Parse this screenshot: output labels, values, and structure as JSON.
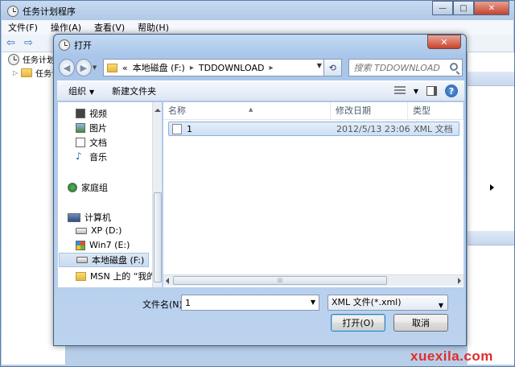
{
  "outer_window": {
    "title": "任务计划程序",
    "menu": [
      "文件(F)",
      "操作(A)",
      "查看(V)",
      "帮助(H)"
    ],
    "tree": [
      "任务计划",
      "任务计"
    ],
    "close_glyph": "✕",
    "min_glyph": "—",
    "max_glyph": "□"
  },
  "dialog": {
    "title": "打开",
    "close_glyph": "✕",
    "address": {
      "prefix": "«",
      "segments": [
        "本地磁盘 (F:)",
        "TDDOWNLOAD"
      ],
      "separator": "▸"
    },
    "search_placeholder": "搜索 TDDOWNLOAD",
    "toolbar": {
      "organize": "组织",
      "new_folder": "新建文件夹",
      "help": "?"
    },
    "nav_items": [
      {
        "label": "视频",
        "icon": "video-icon"
      },
      {
        "label": "图片",
        "icon": "picture-icon"
      },
      {
        "label": "文档",
        "icon": "document-icon"
      },
      {
        "label": "音乐",
        "icon": "music-icon"
      },
      {
        "label": "家庭组",
        "icon": "homegroup-icon"
      },
      {
        "label": "计算机",
        "icon": "computer-icon"
      },
      {
        "label": "XP (D:)",
        "icon": "drive-icon"
      },
      {
        "label": "Win7 (E:)",
        "icon": "windows-drive-icon"
      },
      {
        "label": "本地磁盘 (F:)",
        "icon": "drive-icon",
        "selected": true
      },
      {
        "label": "MSN 上的 “我的",
        "icon": "folder-icon"
      }
    ],
    "columns": [
      "名称",
      "修改日期",
      "类型"
    ],
    "files": [
      {
        "name": "1",
        "modified": "2012/5/13 23:06",
        "type": "XML 文档",
        "selected": true
      }
    ],
    "filename_label": "文件名(N):",
    "filename_value": "1",
    "filetype_value": "XML 文件(*.xml)",
    "open_button": "打开(O)",
    "cancel_button": "取消"
  },
  "watermark": "xuexila.com"
}
